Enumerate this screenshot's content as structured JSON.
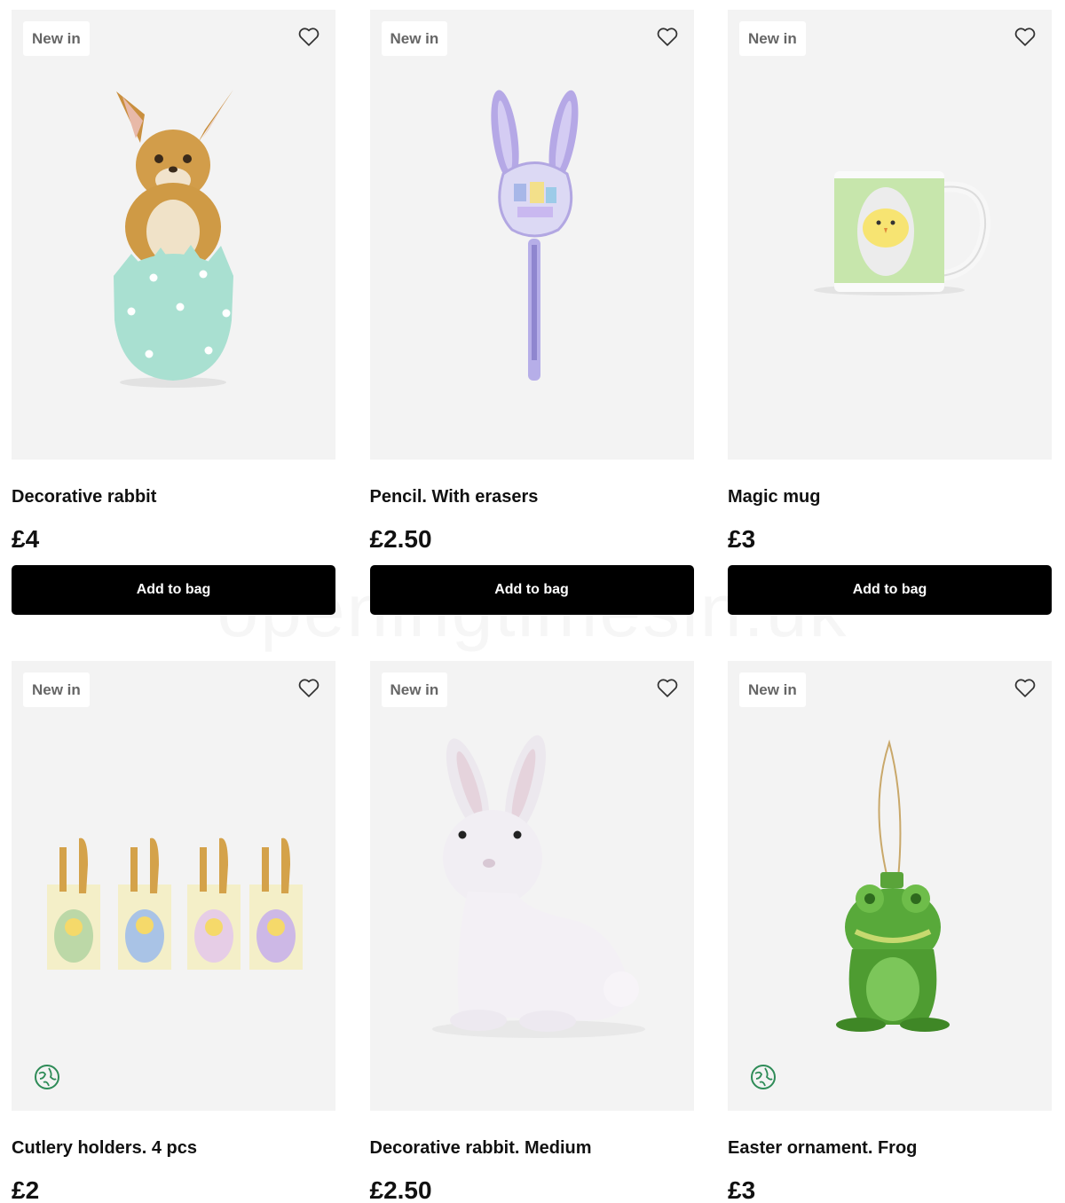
{
  "products": [
    {
      "badge": "New in",
      "name": "Decorative rabbit",
      "price": "£4",
      "cta": "Add to bag",
      "image": "decorative-rabbit-in-egg",
      "eco": false
    },
    {
      "badge": "New in",
      "name": "Pencil. With erasers",
      "price": "£2.50",
      "cta": "Add to bag",
      "image": "bunny-pencil-with-erasers",
      "eco": false
    },
    {
      "badge": "New in",
      "name": "Magic mug",
      "price": "£3",
      "cta": "Add to bag",
      "image": "chick-magic-mug",
      "eco": false
    },
    {
      "badge": "New in",
      "name": "Cutlery holders. 4 pcs",
      "price": "£2",
      "cta": "",
      "image": "chick-cutlery-holders",
      "eco": true
    },
    {
      "badge": "New in",
      "name": "Decorative rabbit. Medium",
      "price": "£2.50",
      "cta": "",
      "image": "white-flocked-rabbit",
      "eco": false
    },
    {
      "badge": "New in",
      "name": "Easter ornament. Frog",
      "price": "£3",
      "cta": "",
      "image": "green-glass-frog-ornament",
      "eco": true
    }
  ],
  "icons": {
    "wishlist": "heart-outline-icon",
    "eco": "globe-leaf-icon"
  },
  "colors": {
    "button": "#000000",
    "card_background": "#f3f3f3",
    "badge_text": "#666666",
    "eco_icon": "#2e8b57"
  },
  "watermark": "openingtimesin.uk"
}
